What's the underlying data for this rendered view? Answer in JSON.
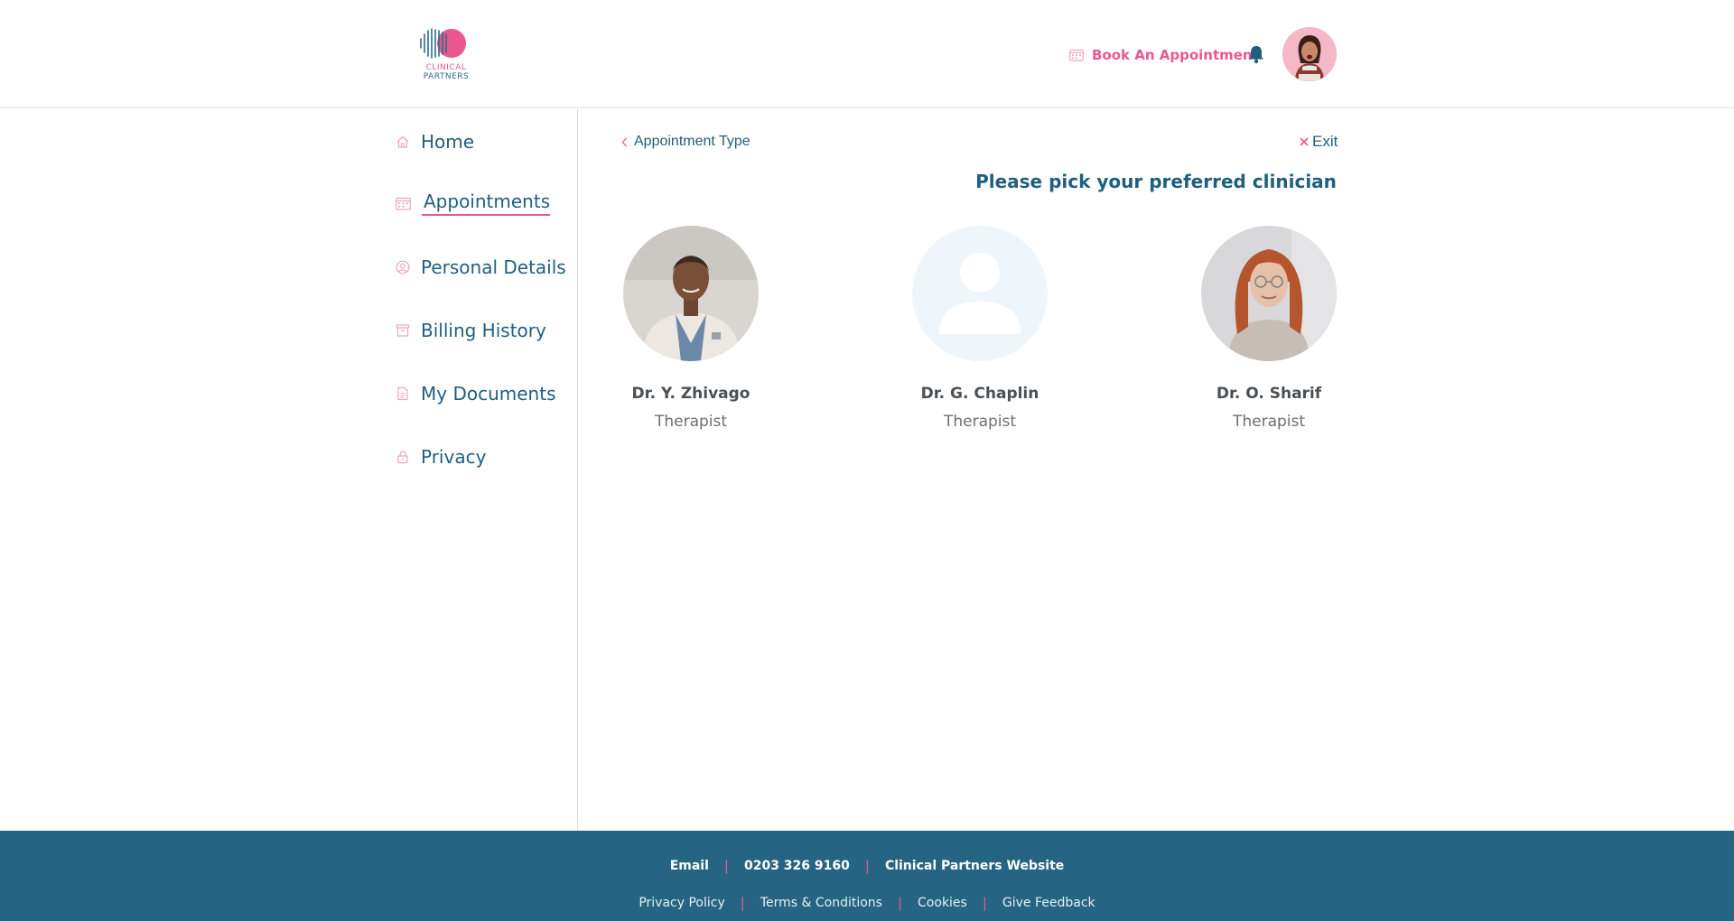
{
  "brand": {
    "line1": "CLINICAL",
    "line2": "PARTNERS"
  },
  "header": {
    "book_label": "Book An Appointment"
  },
  "colors": {
    "accent": "#e8588f",
    "primary": "#1f5f7e",
    "footer_bg": "#256583",
    "placeholder_bg": "#eef6fc"
  },
  "sidebar": {
    "items": [
      {
        "label": "Home",
        "icon": "home-icon"
      },
      {
        "label": "Appointments",
        "icon": "calendar-icon",
        "active": true
      },
      {
        "label": "Personal Details",
        "icon": "user-circle-icon"
      },
      {
        "label": "Billing History",
        "icon": "archive-icon"
      },
      {
        "label": "My Documents",
        "icon": "document-icon"
      },
      {
        "label": "Privacy",
        "icon": "lock-icon"
      }
    ]
  },
  "main": {
    "back_label": "Appointment Type",
    "exit_label": "Exit",
    "title": "Please pick your preferred clinician",
    "clinicians": [
      {
        "name": "Dr. Y. Zhivago",
        "role": "Therapist"
      },
      {
        "name": "Dr. G. Chaplin",
        "role": "Therapist"
      },
      {
        "name": "Dr. O. Sharif",
        "role": "Therapist"
      }
    ]
  },
  "footer": {
    "contact": [
      "Email",
      "0203 326 9160",
      "Clinical Partners Website"
    ],
    "legal": [
      "Privacy Policy",
      "Terms & Conditions",
      "Cookies",
      "Give Feedback"
    ]
  }
}
